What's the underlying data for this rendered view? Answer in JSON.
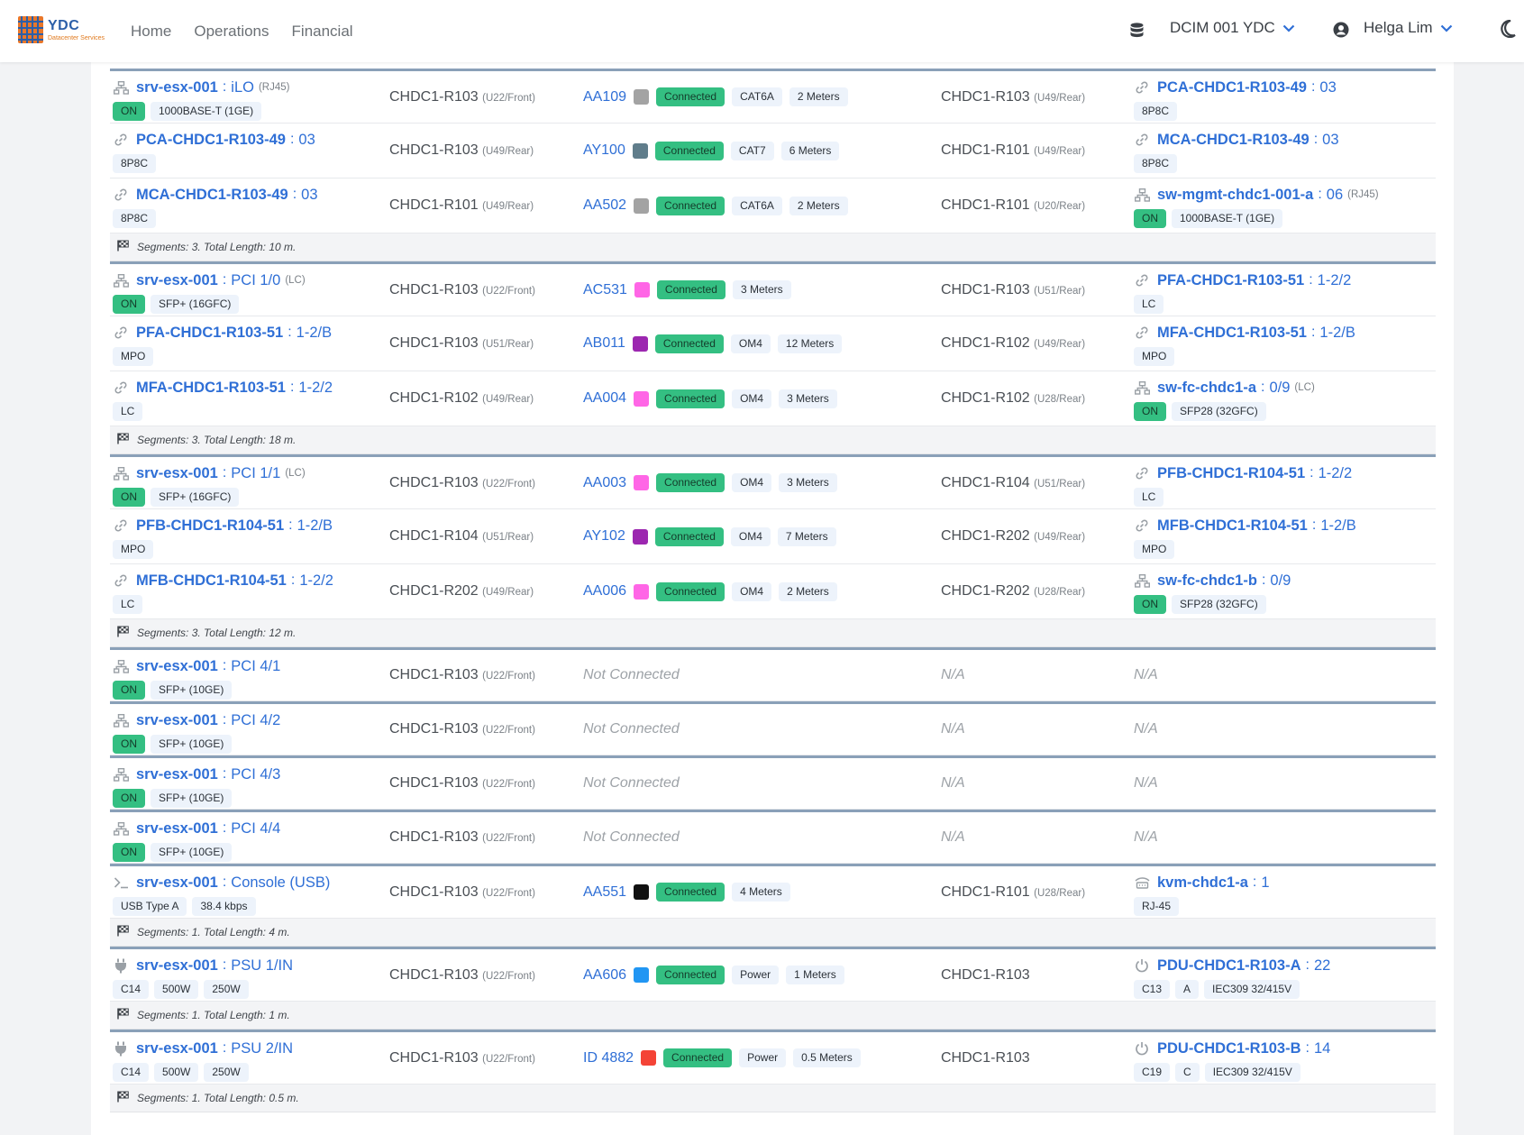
{
  "nav": {
    "brand": "YDC",
    "brand_sub": "Datacenter Services",
    "links": [
      "Home",
      "Operations",
      "Financial"
    ],
    "site": "DCIM 001 YDC",
    "user": "Helga Lim"
  },
  "colors": {
    "accent": "#2f6fd6",
    "connected": "#34bf82",
    "group_rule": "#8aa0b8"
  },
  "status": {
    "on": "ON",
    "connected": "Connected",
    "not_connected": "Not Connected",
    "na": "N/A"
  },
  "rows": [
    {
      "group_start": true,
      "a": {
        "icon": "network-icon",
        "dev": "srv-esx-001",
        "port": "iLO",
        "type": "(RJ45)",
        "badges": [
          "ON",
          "1000BASE-T (1GE)"
        ]
      },
      "rack_a": {
        "name": "CHDC1-R103",
        "pos": "(U22/Front)"
      },
      "cable": {
        "id": "AA109",
        "color": "#a3a3a3",
        "badges": [
          "Connected",
          "CAT6A",
          "2 Meters"
        ]
      },
      "rack_b": {
        "name": "CHDC1-R103",
        "pos": "(U49/Rear)"
      },
      "b": {
        "icon": "link-icon",
        "dev": "PCA-CHDC1-R103-49",
        "port": "03",
        "type": "",
        "badges": [
          "8P8C"
        ]
      }
    },
    {
      "a": {
        "icon": "link-icon",
        "dev": "PCA-CHDC1-R103-49",
        "port": "03",
        "type": "",
        "badges": [
          "8P8C"
        ]
      },
      "rack_a": {
        "name": "CHDC1-R103",
        "pos": "(U49/Rear)"
      },
      "cable": {
        "id": "AY100",
        "color": "#607d8b",
        "badges": [
          "Connected",
          "CAT7",
          "6 Meters"
        ]
      },
      "rack_b": {
        "name": "CHDC1-R101",
        "pos": "(U49/Rear)"
      },
      "b": {
        "icon": "link-icon",
        "dev": "MCA-CHDC1-R103-49",
        "port": "03",
        "type": "",
        "badges": [
          "8P8C"
        ]
      }
    },
    {
      "a": {
        "icon": "link-icon",
        "dev": "MCA-CHDC1-R103-49",
        "port": "03",
        "type": "",
        "badges": [
          "8P8C"
        ]
      },
      "rack_a": {
        "name": "CHDC1-R101",
        "pos": "(U49/Rear)"
      },
      "cable": {
        "id": "AA502",
        "color": "#a3a3a3",
        "badges": [
          "Connected",
          "CAT6A",
          "2 Meters"
        ]
      },
      "rack_b": {
        "name": "CHDC1-R101",
        "pos": "(U20/Rear)"
      },
      "b": {
        "icon": "network-icon",
        "dev": "sw-mgmt-chdc1-001-a",
        "port": "06",
        "type": "(RJ45)",
        "badges": [
          "ON",
          "1000BASE-T (1GE)"
        ]
      }
    },
    {
      "summary": "Segments: 3. Total Length: 10 m."
    },
    {
      "group_start": true,
      "a": {
        "icon": "network-icon",
        "dev": "srv-esx-001",
        "port": "PCI 1/0",
        "type": "(LC)",
        "badges": [
          "ON",
          "SFP+ (16GFC)"
        ]
      },
      "rack_a": {
        "name": "CHDC1-R103",
        "pos": "(U22/Front)"
      },
      "cable": {
        "id": "AC531",
        "color": "#ff66e6",
        "badges": [
          "Connected",
          "3 Meters"
        ]
      },
      "rack_b": {
        "name": "CHDC1-R103",
        "pos": "(U51/Rear)"
      },
      "b": {
        "icon": "link-icon",
        "dev": "PFA-CHDC1-R103-51",
        "port": "1-2/2",
        "type": "",
        "badges": [
          "LC"
        ]
      }
    },
    {
      "a": {
        "icon": "link-icon",
        "dev": "PFA-CHDC1-R103-51",
        "port": "1-2/B",
        "type": "",
        "badges": [
          "MPO"
        ]
      },
      "rack_a": {
        "name": "CHDC1-R103",
        "pos": "(U51/Rear)"
      },
      "cable": {
        "id": "AB011",
        "color": "#9c27b0",
        "badges": [
          "Connected",
          "OM4",
          "12 Meters"
        ]
      },
      "rack_b": {
        "name": "CHDC1-R102",
        "pos": "(U49/Rear)"
      },
      "b": {
        "icon": "link-icon",
        "dev": "MFA-CHDC1-R103-51",
        "port": "1-2/B",
        "type": "",
        "badges": [
          "MPO"
        ]
      }
    },
    {
      "a": {
        "icon": "link-icon",
        "dev": "MFA-CHDC1-R103-51",
        "port": "1-2/2",
        "type": "",
        "badges": [
          "LC"
        ]
      },
      "rack_a": {
        "name": "CHDC1-R102",
        "pos": "(U49/Rear)"
      },
      "cable": {
        "id": "AA004",
        "color": "#ff66e6",
        "badges": [
          "Connected",
          "OM4",
          "3 Meters"
        ]
      },
      "rack_b": {
        "name": "CHDC1-R102",
        "pos": "(U28/Rear)"
      },
      "b": {
        "icon": "network-icon",
        "dev": "sw-fc-chdc1-a",
        "port": "0/9",
        "type": "(LC)",
        "badges": [
          "ON",
          "SFP28 (32GFC)"
        ]
      }
    },
    {
      "summary": "Segments: 3. Total Length: 18 m."
    },
    {
      "group_start": true,
      "a": {
        "icon": "network-icon",
        "dev": "srv-esx-001",
        "port": "PCI 1/1",
        "type": "(LC)",
        "badges": [
          "ON",
          "SFP+ (16GFC)"
        ]
      },
      "rack_a": {
        "name": "CHDC1-R103",
        "pos": "(U22/Front)"
      },
      "cable": {
        "id": "AA003",
        "color": "#ff66e6",
        "badges": [
          "Connected",
          "OM4",
          "3 Meters"
        ]
      },
      "rack_b": {
        "name": "CHDC1-R104",
        "pos": "(U51/Rear)"
      },
      "b": {
        "icon": "link-icon",
        "dev": "PFB-CHDC1-R104-51",
        "port": "1-2/2",
        "type": "",
        "badges": [
          "LC"
        ]
      }
    },
    {
      "a": {
        "icon": "link-icon",
        "dev": "PFB-CHDC1-R104-51",
        "port": "1-2/B",
        "type": "",
        "badges": [
          "MPO"
        ]
      },
      "rack_a": {
        "name": "CHDC1-R104",
        "pos": "(U51/Rear)"
      },
      "cable": {
        "id": "AY102",
        "color": "#9c27b0",
        "badges": [
          "Connected",
          "OM4",
          "7 Meters"
        ]
      },
      "rack_b": {
        "name": "CHDC1-R202",
        "pos": "(U49/Rear)"
      },
      "b": {
        "icon": "link-icon",
        "dev": "MFB-CHDC1-R104-51",
        "port": "1-2/B",
        "type": "",
        "badges": [
          "MPO"
        ]
      }
    },
    {
      "a": {
        "icon": "link-icon",
        "dev": "MFB-CHDC1-R104-51",
        "port": "1-2/2",
        "type": "",
        "badges": [
          "LC"
        ]
      },
      "rack_a": {
        "name": "CHDC1-R202",
        "pos": "(U49/Rear)"
      },
      "cable": {
        "id": "AA006",
        "color": "#ff66e6",
        "badges": [
          "Connected",
          "OM4",
          "2 Meters"
        ]
      },
      "rack_b": {
        "name": "CHDC1-R202",
        "pos": "(U28/Rear)"
      },
      "b": {
        "icon": "network-icon",
        "dev": "sw-fc-chdc1-b",
        "port": "0/9",
        "type": "",
        "badges": [
          "ON",
          "SFP28 (32GFC)"
        ]
      }
    },
    {
      "summary": "Segments: 3. Total Length: 12 m."
    },
    {
      "group_start": true,
      "single": true,
      "a": {
        "icon": "network-icon",
        "dev": "srv-esx-001",
        "port": "PCI 4/1",
        "type": "",
        "badges": [
          "ON",
          "SFP+ (10GE)"
        ]
      },
      "rack_a": {
        "name": "CHDC1-R103",
        "pos": "(U22/Front)"
      },
      "not_connected": true
    },
    {
      "group_start": true,
      "single": true,
      "a": {
        "icon": "network-icon",
        "dev": "srv-esx-001",
        "port": "PCI 4/2",
        "type": "",
        "badges": [
          "ON",
          "SFP+ (10GE)"
        ]
      },
      "rack_a": {
        "name": "CHDC1-R103",
        "pos": "(U22/Front)"
      },
      "not_connected": true
    },
    {
      "group_start": true,
      "single": true,
      "a": {
        "icon": "network-icon",
        "dev": "srv-esx-001",
        "port": "PCI 4/3",
        "type": "",
        "badges": [
          "ON",
          "SFP+ (10GE)"
        ]
      },
      "rack_a": {
        "name": "CHDC1-R103",
        "pos": "(U22/Front)"
      },
      "not_connected": true
    },
    {
      "group_start": true,
      "single": true,
      "a": {
        "icon": "network-icon",
        "dev": "srv-esx-001",
        "port": "PCI 4/4",
        "type": "",
        "badges": [
          "ON",
          "SFP+ (10GE)"
        ]
      },
      "rack_a": {
        "name": "CHDC1-R103",
        "pos": "(U22/Front)"
      },
      "not_connected": true
    },
    {
      "group_start": true,
      "a": {
        "icon": "console-icon",
        "dev": "srv-esx-001",
        "port": "Console (USB)",
        "type": "",
        "badges": [
          "USB Type A",
          "38.4 kbps"
        ]
      },
      "rack_a": {
        "name": "CHDC1-R103",
        "pos": "(U22/Front)"
      },
      "cable": {
        "id": "AA551",
        "color": "#111111",
        "badges": [
          "Connected",
          "4 Meters"
        ]
      },
      "rack_b": {
        "name": "CHDC1-R101",
        "pos": "(U28/Rear)"
      },
      "b": {
        "icon": "kvm-icon",
        "dev": "kvm-chdc1-a",
        "port": "1",
        "type": "",
        "badges": [
          "RJ-45"
        ]
      }
    },
    {
      "summary": "Segments: 1. Total Length: 4 m."
    },
    {
      "group_start": true,
      "a": {
        "icon": "plug-icon",
        "dev": "srv-esx-001",
        "port": "PSU 1/IN",
        "type": "",
        "badges": [
          "C14",
          "500W",
          "250W"
        ]
      },
      "rack_a": {
        "name": "CHDC1-R103",
        "pos": "(U22/Front)"
      },
      "cable": {
        "id": "AA606",
        "color": "#2196f3",
        "badges": [
          "Connected",
          "Power",
          "1 Meters"
        ]
      },
      "rack_b": {
        "name": "CHDC1-R103",
        "pos": ""
      },
      "b": {
        "icon": "power-icon",
        "dev": "PDU-CHDC1-R103-A",
        "port": "22",
        "type": "",
        "badges": [
          "C13",
          "A",
          "IEC309 32/415V"
        ]
      }
    },
    {
      "summary": "Segments: 1. Total Length: 1 m."
    },
    {
      "group_start": true,
      "a": {
        "icon": "plug-icon",
        "dev": "srv-esx-001",
        "port": "PSU 2/IN",
        "type": "",
        "badges": [
          "C14",
          "500W",
          "250W"
        ]
      },
      "rack_a": {
        "name": "CHDC1-R103",
        "pos": "(U22/Front)"
      },
      "cable": {
        "id": "ID 4882",
        "color": "#f44336",
        "badges": [
          "Connected",
          "Power",
          "0.5 Meters"
        ]
      },
      "rack_b": {
        "name": "CHDC1-R103",
        "pos": ""
      },
      "b": {
        "icon": "power-icon",
        "dev": "PDU-CHDC1-R103-B",
        "port": "14",
        "type": "",
        "badges": [
          "C19",
          "C",
          "IEC309 32/415V"
        ]
      }
    },
    {
      "summary": "Segments: 1. Total Length: 0.5 m."
    }
  ]
}
